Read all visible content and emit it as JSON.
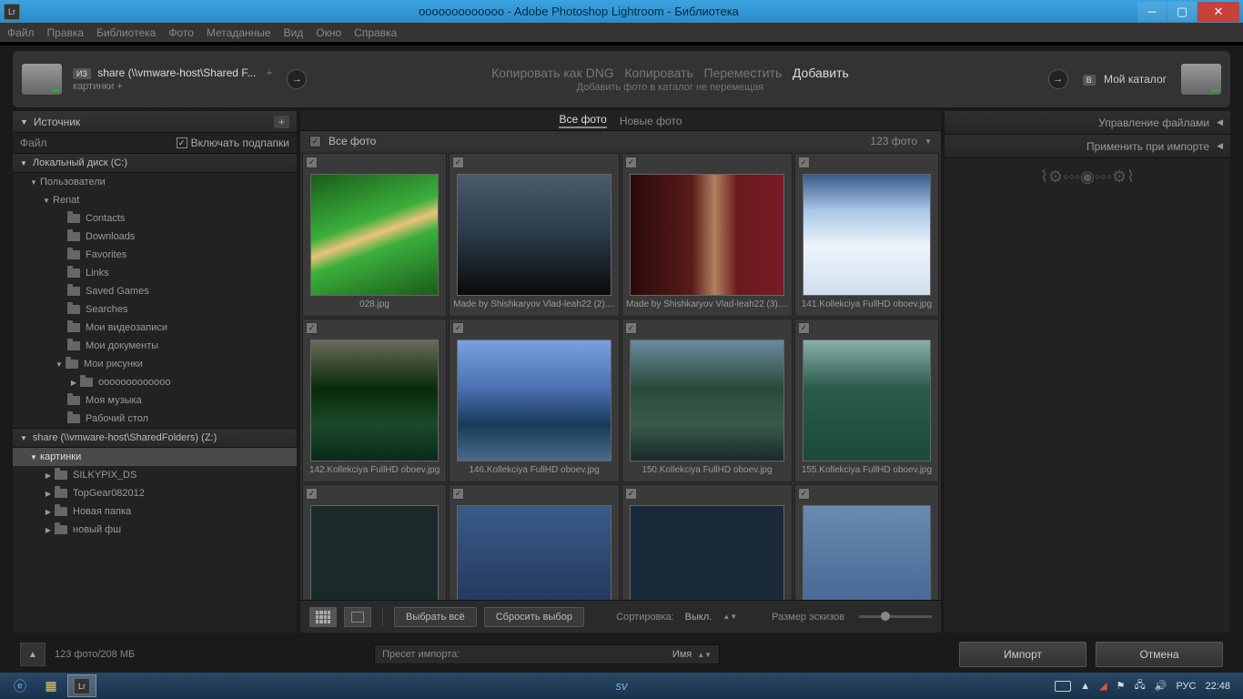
{
  "titlebar": {
    "app_icon": "Lr",
    "title": "ooooooooooooo - Adobe Photoshop Lightroom - Библиотека"
  },
  "menubar": [
    "Файл",
    "Правка",
    "Библиотека",
    "Фото",
    "Метаданные",
    "Вид",
    "Окно",
    "Справка"
  ],
  "header": {
    "from_badge": "ИЗ",
    "from_path": "share (\\\\vmware-host\\Shared F...",
    "from_selector": "÷",
    "from_sub": "картинки +",
    "ops": [
      "Копировать как DNG",
      "Копировать",
      "Переместить",
      "Добавить"
    ],
    "ops_sub": "Добавить фото в каталог не перемещая",
    "to_badge": "В",
    "to_text": "Мой каталог"
  },
  "left": {
    "title": "Источник",
    "file_label": "Файл",
    "include_sub": "Включать подпапки",
    "drive_c": "Локальный диск (C:)",
    "users": "Пользователи",
    "user": "Renat",
    "folders_user": [
      "Contacts",
      "Downloads",
      "Favorites",
      "Links",
      "Saved Games",
      "Searches",
      "Мои видеозаписи",
      "Мои документы"
    ],
    "pics": "Мои рисунки",
    "pics_sub": "ooooooooooooo",
    "after_pics": [
      "Моя музыка",
      "Рабочий стол"
    ],
    "drive_z": "share (\\\\vmware-host\\SharedFolders) (Z:)",
    "z_selected": "картинки",
    "z_sub": [
      "SILKYPIX_DS",
      "TopGear082012",
      "Новая папка",
      "новый фш"
    ]
  },
  "center": {
    "tab_all": "Все фото",
    "tab_new": "Новые фото",
    "allbar_label": "Все фото",
    "allbar_count": "123 фото",
    "thumbs": [
      "028.jpg",
      "Made by Shishkaryov Vlad-leah22 (2)....",
      "Made by Shishkaryov Vlad-leah22 (3)....",
      "141.Kollekciya FullHD oboev.jpg",
      "142.Kollekciya FullHD oboev.jpg",
      "146.Kollekciya FullHD oboev.jpg",
      "150.Kollekciya FullHD oboev.jpg",
      "155.Kollekciya FullHD oboev.jpg"
    ],
    "btn_select_all": "Выбрать всё",
    "btn_deselect": "Сбросить выбор",
    "sort_label": "Сортировка:",
    "sort_value": "Выкл.",
    "size_label": "Размер эскизов"
  },
  "right": {
    "row1": "Управление файлами",
    "row2": "Применить при импорте"
  },
  "footer": {
    "stats": "123 фото/208 МБ",
    "preset_label": "Пресет импорта:",
    "preset_value": "Имя",
    "btn_import": "Импорт",
    "btn_cancel": "Отмена"
  },
  "taskbar": {
    "lang": "РУС",
    "clock": "22:48",
    "sv": "sv"
  }
}
